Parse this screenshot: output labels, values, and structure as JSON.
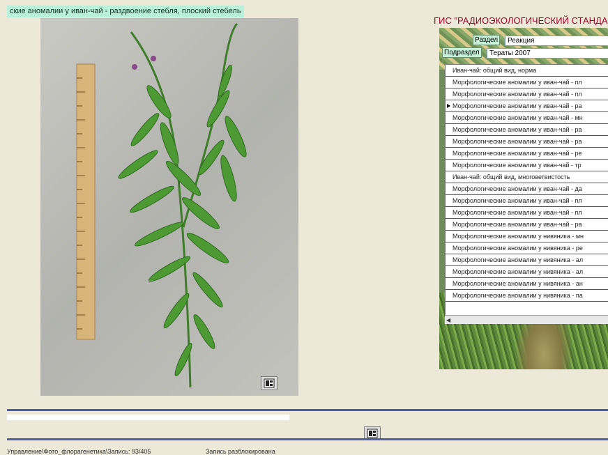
{
  "photo_caption": "ские аномалии у иван-чай - раздвоение стебля, плоский стебель",
  "right_panel": {
    "title": "ГИС \"РАДИОЭКОЛОГИЧЕСКИЙ СТАНДАРТ\"",
    "section_label": "Раздел",
    "section_value": "Реакция",
    "subsection_label": "Подраздел",
    "subsection_value": "Тераты 2007",
    "list_items": [
      "Иван-чай: общий вид, норма",
      "Морфологические аномалии у иван-чай - пл",
      "Морфологические аномалии у иван-чай - пл",
      "Морфологические аномалии у иван-чай - ра",
      "Морфологические аномалии у иван-чай - мн",
      "Морфологические аномалии у иван-чай - ра",
      "Морфологические аномалии у иван-чай - ра",
      "Морфологические аномалии у иван-чай - ре",
      "Морфологические аномалии у иван-чай - тр",
      "Иван-чай: общий вид, многоветвистость",
      "Морфологические аномалии у иван-чай - да",
      "Морфологические аномалии у иван-чай - пл",
      "Морфологические аномалии у иван-чай - пл",
      "Морфологические аномалии у иван-чай - ра",
      "Морфологические аномалии у нивяника - мн",
      "Морфологические аномалии у нивяника - ре",
      "Морфологические аномалии у нивяника - ал",
      "Морфологические аномалии у нивяника - ал",
      "Морфологические аномалии у нивяника - ан",
      "Морфологические аномалии у нивяника - па"
    ],
    "selected_index": 3
  },
  "status_bar": {
    "left": "Управление\\Фото_флорагенетика\\Запись: 93/405",
    "right": "Запись разблокирована"
  },
  "icons": {
    "photo_zoom": "zoom-icon",
    "bottom_zoom": "zoom-icon"
  },
  "colors": {
    "accent": "#4a5fa5",
    "title": "#a5002a",
    "caption_bg": "#b9f0dc"
  }
}
